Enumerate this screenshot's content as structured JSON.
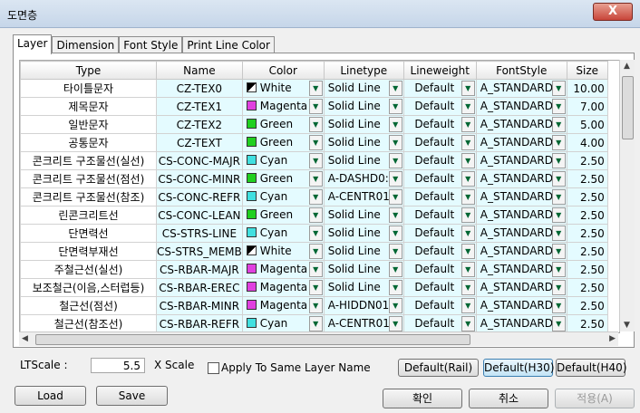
{
  "window": {
    "title": "도면층",
    "close_label": "X"
  },
  "tabs": [
    "Layer",
    "Dimension",
    "Font Style",
    "Print Line Color"
  ],
  "columns": [
    "Type",
    "Name",
    "Color",
    "Linetype",
    "Lineweight",
    "FontStyle",
    "Size"
  ],
  "colors": {
    "White": "#ffffff",
    "Magenta": "#e040e0",
    "Green": "#20d020",
    "Cyan": "#40e0e0"
  },
  "rows": [
    {
      "type": "타이틀문자",
      "name": "CZ-TEX0",
      "color": "White",
      "linetype": "Solid Line",
      "lineweight": "Default",
      "font": "A_STANDARD",
      "size": "10.00"
    },
    {
      "type": "제목문자",
      "name": "CZ-TEX1",
      "color": "Magenta",
      "linetype": "Solid Line",
      "lineweight": "Default",
      "font": "A_STANDARD",
      "size": "7.00"
    },
    {
      "type": "일반문자",
      "name": "CZ-TEX2",
      "color": "Green",
      "linetype": "Solid Line",
      "lineweight": "Default",
      "font": "A_STANDARD",
      "size": "5.00"
    },
    {
      "type": "공통문자",
      "name": "CZ-TEXT",
      "color": "Green",
      "linetype": "Solid Line",
      "lineweight": "Default",
      "font": "A_STANDARD",
      "size": "4.00"
    },
    {
      "type": "콘크리트 구조물선(실선)",
      "name": "CS-CONC-MAJR",
      "color": "Cyan",
      "linetype": "Solid Line",
      "lineweight": "Default",
      "font": "A_STANDARD",
      "size": "2.50"
    },
    {
      "type": "콘크리트 구조물선(점선)",
      "name": "CS-CONC-MINR",
      "color": "Green",
      "linetype": "A-DASHD0:",
      "lineweight": "Default",
      "font": "A_STANDARD",
      "size": "2.50"
    },
    {
      "type": "콘크리트 구조물선(참조)",
      "name": "CS-CONC-REFR",
      "color": "Cyan",
      "linetype": "A-CENTR01",
      "lineweight": "Default",
      "font": "A_STANDARD",
      "size": "2.50"
    },
    {
      "type": "린콘크리트선",
      "name": "CS-CONC-LEAN",
      "color": "Green",
      "linetype": "Solid Line",
      "lineweight": "Default",
      "font": "A_STANDARD",
      "size": "2.50"
    },
    {
      "type": "단면력선",
      "name": "CS-STRS-LINE",
      "color": "Cyan",
      "linetype": "Solid Line",
      "lineweight": "Default",
      "font": "A_STANDARD",
      "size": "2.50"
    },
    {
      "type": "단면력부재선",
      "name": "CS-STRS_MEMB",
      "color": "White",
      "linetype": "Solid Line",
      "lineweight": "Default",
      "font": "A_STANDARD",
      "size": "2.50"
    },
    {
      "type": "주철근선(실선)",
      "name": "CS-RBAR-MAJR",
      "color": "Magenta",
      "linetype": "Solid Line",
      "lineweight": "Default",
      "font": "A_STANDARD",
      "size": "2.50"
    },
    {
      "type": "보조철근(이음,스터럽등)",
      "name": "CS-RBAR-EREC",
      "color": "Magenta",
      "linetype": "Solid Line",
      "lineweight": "Default",
      "font": "A_STANDARD",
      "size": "2.50"
    },
    {
      "type": "철근선(점선)",
      "name": "CS-RBAR-MINR",
      "color": "Magenta",
      "linetype": "A-HIDDN01",
      "lineweight": "Default",
      "font": "A_STANDARD",
      "size": "2.50"
    },
    {
      "type": "철근선(참조선)",
      "name": "CS-RBAR-REFR",
      "color": "Cyan",
      "linetype": "A-CENTR01",
      "lineweight": "Default",
      "font": "A_STANDARD",
      "size": "2.50"
    }
  ],
  "bottom": {
    "ltscale_label": "LTScale :",
    "ltscale_value": "5.5",
    "xscale_label": "X Scale",
    "apply_label": "Apply To Same Layer Name",
    "preset_buttons": [
      "Default(Rail)",
      "Default(H30)",
      "Default(H40)"
    ],
    "load_label": "Load",
    "save_label": "Save",
    "ok_label": "확인",
    "cancel_label": "취소",
    "apply_btn_label": "적용(A)"
  }
}
